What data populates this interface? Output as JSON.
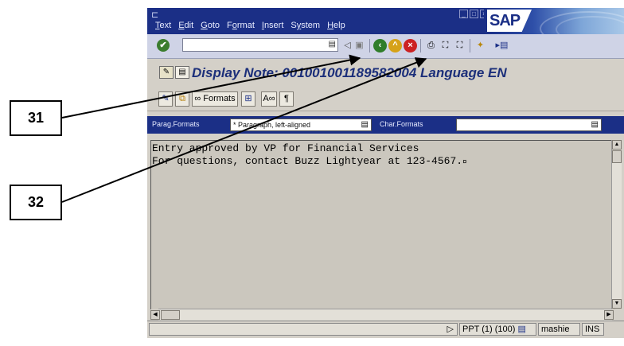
{
  "menubar": {
    "items": [
      {
        "label": "Text",
        "ul": "T"
      },
      {
        "label": "Edit",
        "ul": "E"
      },
      {
        "label": "Goto",
        "ul": "G"
      },
      {
        "label": "Format",
        "ul": "o"
      },
      {
        "label": "Insert",
        "ul": "I"
      },
      {
        "label": "System",
        "ul": "y"
      },
      {
        "label": "Help",
        "ul": "H"
      }
    ],
    "logo_text": "SAP"
  },
  "toolbar": {
    "command_field_value": ""
  },
  "titlebar": {
    "title": "Display Note: 00100100118958200​4 Language EN"
  },
  "appbar": {
    "formats_label": "Formats",
    "paragraph_mark": "¶"
  },
  "formatbar": {
    "parag_label": "Parag.Formats",
    "parag_value": "* Paragraph, left-aligned",
    "char_label": "Char.Formats",
    "char_value": ""
  },
  "editor": {
    "lines": [
      "Entry approved by VP for Financial Services",
      "For questions, contact Buzz Lightyear at 123-4567."
    ],
    "end_marker": "¤"
  },
  "statusbar": {
    "system": "PPT (1) (100)",
    "user": "mashie",
    "mode": "INS"
  },
  "callouts": [
    {
      "label": "31"
    },
    {
      "label": "32"
    }
  ],
  "colors": {
    "menubar_bg": "#1b2f86",
    "title_text": "#1c2f7a",
    "editor_bg": "#cbc7be"
  }
}
